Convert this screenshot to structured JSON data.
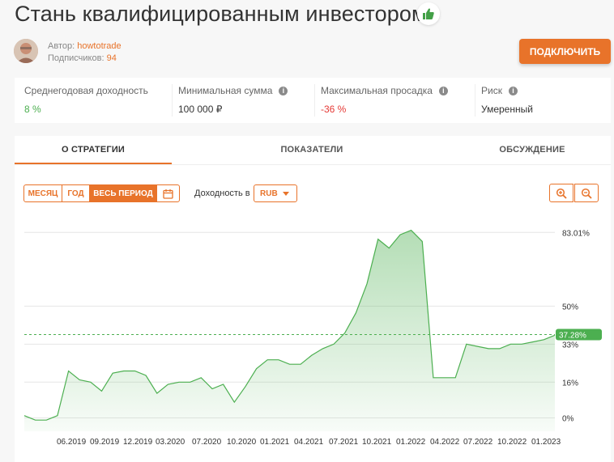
{
  "header": {
    "title": "Стань квалифицированным инвестором!",
    "author_label": "Автор:",
    "author_name": "howtotrade",
    "subscribers_label": "Подписчиков:",
    "subscribers_count": "94",
    "connect_label": "ПОДКЛЮЧИТЬ"
  },
  "stats": [
    {
      "label": "Среднегодовая доходность",
      "value": "8 %",
      "color": "#4caf50"
    },
    {
      "label": "Минимальная сумма",
      "value": "100 000 ₽",
      "color": "#333333"
    },
    {
      "label": "Максимальная просадка",
      "value": "-36 %",
      "color": "#e53935"
    },
    {
      "label": "Риск",
      "value": "Умеренный",
      "color": "#333333"
    }
  ],
  "tabs": [
    "О СТРАТЕГИИ",
    "ПОКАЗАТЕЛИ",
    "ОБСУЖДЕНИЕ"
  ],
  "controls": {
    "periods": [
      "МЕСЯЦ",
      "ГОД",
      "ВЕСЬ ПЕРИОД"
    ],
    "active_period": "ВЕСЬ ПЕРИОД",
    "yield_label": "Доходность в",
    "currency": "RUB"
  },
  "colors": {
    "accent": "#e8732a",
    "positive": "#4caf50",
    "negative": "#e53935"
  },
  "chart_data": {
    "type": "area",
    "y_tick_labels": [
      "83.01%",
      "50%",
      "33%",
      "16%",
      "0%"
    ],
    "y_ticks": [
      83.01,
      50,
      33,
      16,
      0
    ],
    "ylim": [
      -6,
      90
    ],
    "current_label": "37.28%",
    "current_value": 37.28,
    "x_tick_labels": [
      "06.2019",
      "09.2019",
      "12.2019",
      "03.2020",
      "07.2020",
      "10.2020",
      "01.2021",
      "04.2021",
      "07.2021",
      "10.2021",
      "01.2022",
      "04.2022",
      "07.2022",
      "10.2022",
      "01.2023"
    ],
    "x_start": "2019-03",
    "x_end": "2023-03",
    "series": [
      {
        "x": [
          "2019-03",
          "2019-04",
          "2019-05",
          "2019-06",
          "2019-07",
          "2019-08",
          "2019-09",
          "2019-10",
          "2019-11",
          "2019-12",
          "2020-01",
          "2020-02",
          "2020-03",
          "2020-04",
          "2020-05",
          "2020-06",
          "2020-07",
          "2020-08",
          "2020-09",
          "2020-10",
          "2020-11",
          "2020-12",
          "2021-01",
          "2021-02",
          "2021-03",
          "2021-04",
          "2021-05",
          "2021-06",
          "2021-07",
          "2021-08",
          "2021-09",
          "2021-10",
          "2021-11",
          "2021-12",
          "2022-01",
          "2022-02",
          "2022-03",
          "2022-04",
          "2022-05",
          "2022-06",
          "2022-07",
          "2022-08",
          "2022-09",
          "2022-10",
          "2022-11",
          "2022-12",
          "2023-01",
          "2023-02",
          "2023-03"
        ],
        "y": [
          1,
          -1,
          -1,
          1,
          21,
          17,
          16,
          12,
          20,
          21,
          21,
          19,
          11,
          15,
          16,
          16,
          18,
          13,
          15,
          7,
          14,
          22,
          26,
          26,
          24,
          24,
          28,
          31,
          33,
          38,
          47,
          60,
          80,
          76,
          82,
          84,
          79,
          18,
          18,
          18,
          33,
          32,
          31,
          31,
          33,
          33,
          34,
          35,
          37
        ],
        "color": "#4caf50"
      }
    ]
  }
}
